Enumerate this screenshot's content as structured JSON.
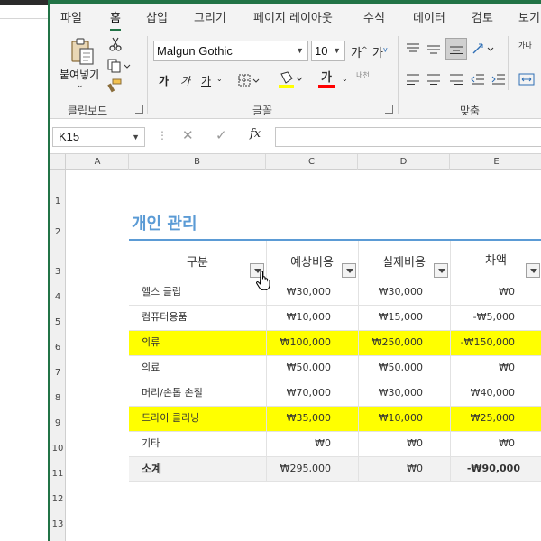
{
  "ribbon_tabs": [
    "파일",
    "홈",
    "삽입",
    "그리기",
    "페이지 레이아웃",
    "수식",
    "데이터",
    "검토",
    "보기"
  ],
  "ribbon": {
    "paste_label": "붙여넣기",
    "clipboard_group": "클립보드",
    "font_group": "글꼴",
    "align_group": "맞춤",
    "font_name": "Malgun Gothic",
    "font_size": "10",
    "bold": "가",
    "italic": "가",
    "underline": "가",
    "font_color_glyph": "가",
    "phonetic_label": "내천",
    "wrap_label": "가나",
    "fill_color": "#ffff00",
    "font_color": "#ff0000"
  },
  "formula_bar": {
    "name_box": "K15",
    "formula": ""
  },
  "columns": [
    "A",
    "B",
    "C",
    "D",
    "E"
  ],
  "rows": [
    "1",
    "2",
    "3",
    "4",
    "5",
    "6",
    "7",
    "8",
    "9",
    "10",
    "11",
    "12",
    "13"
  ],
  "sheet": {
    "title": "개인 관리",
    "headers": [
      "구분",
      "예상비용",
      "실제비용",
      "차액"
    ],
    "data": [
      {
        "cat": "헬스 클럽",
        "est": "₩30,000",
        "act": "₩30,000",
        "diff": "₩0",
        "highlight": false
      },
      {
        "cat": "컴퓨터용품",
        "est": "₩10,000",
        "act": "₩15,000",
        "diff": "-₩5,000",
        "highlight": false
      },
      {
        "cat": "의류",
        "est": "₩100,000",
        "act": "₩250,000",
        "diff": "-₩150,000",
        "highlight": true
      },
      {
        "cat": "의료",
        "est": "₩50,000",
        "act": "₩50,000",
        "diff": "₩0",
        "highlight": false
      },
      {
        "cat": "머리/손톱 손질",
        "est": "₩70,000",
        "act": "₩30,000",
        "diff": "₩40,000",
        "highlight": false
      },
      {
        "cat": "드라이 클리닝",
        "est": "₩35,000",
        "act": "₩10,000",
        "diff": "₩25,000",
        "highlight": true
      },
      {
        "cat": "기타",
        "est": "₩0",
        "act": "₩0",
        "diff": "₩0",
        "highlight": false
      }
    ],
    "total": {
      "label": "소계",
      "est": "₩295,000",
      "act": "₩0",
      "diff": "-₩90,000"
    },
    "highlight_color": "#ffff00",
    "title_color": "#5b9bd5"
  }
}
